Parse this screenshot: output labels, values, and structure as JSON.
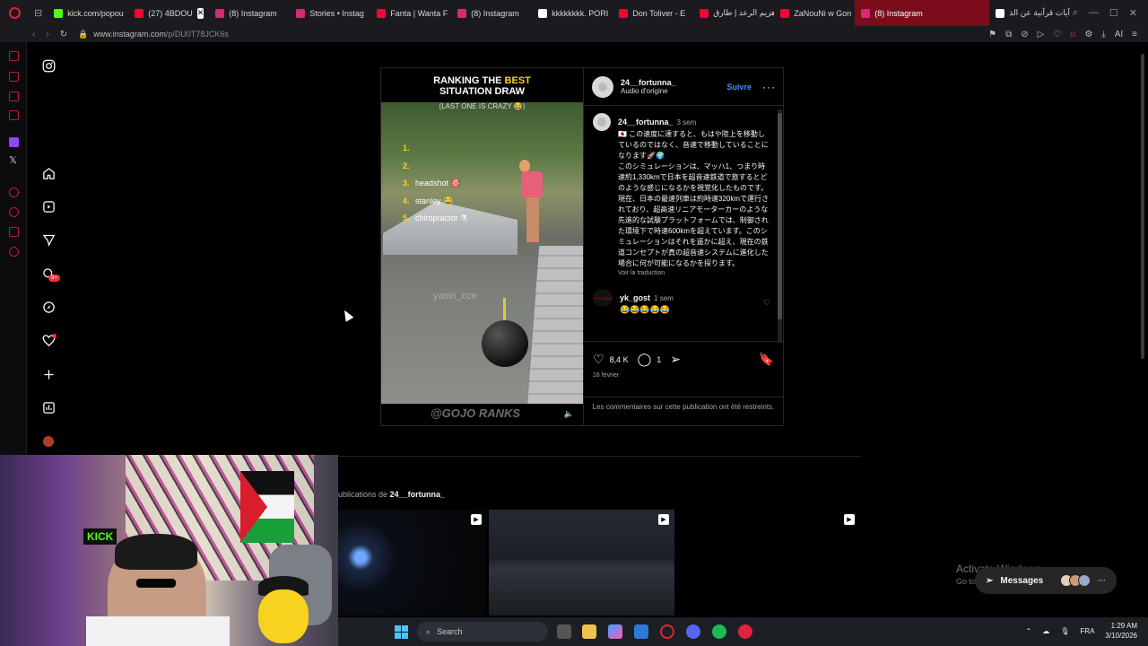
{
  "browser": {
    "tabs": [
      {
        "label": "kick.com/popou",
        "color": "#53fc18"
      },
      {
        "label": "(27) 4BDOU",
        "color": "#ff0033"
      },
      {
        "label": "(8) Instagram",
        "color": "#d62976"
      },
      {
        "label": "Stories • Instag",
        "color": "#d62976"
      },
      {
        "label": "Fanta | Wanta F",
        "color": "#ff0033"
      },
      {
        "label": "(8) Instagram",
        "color": "#d62976"
      },
      {
        "label": "kkkkkkkk. PORI",
        "color": "#ffffff"
      },
      {
        "label": "Don Toliver - E",
        "color": "#ff0033"
      },
      {
        "label": "هزيم الرعد | طارق",
        "color": "#ff0033"
      },
      {
        "label": "ZaNouNi w Gon",
        "color": "#ff0033"
      },
      {
        "label": "(8) Instagram",
        "color": "#d62976"
      },
      {
        "label": "آيات قرآنية عن الذ",
        "color": "#ffffff"
      }
    ],
    "url_host": "www.instagram.com",
    "url_path": "/p/DU0T78JCK6s",
    "ai_label": "AI"
  },
  "post": {
    "video": {
      "title_pre": "RANKING THE ",
      "title_accent": "BEST",
      "title_line2": "SITUATION DRAW",
      "title_sub": "(LAST ONE IS CRAZY 😂)",
      "ranks": [
        {
          "n": "1.",
          "label": ""
        },
        {
          "n": "2.",
          "label": ""
        },
        {
          "n": "3.",
          "label": "headshot 🎯"
        },
        {
          "n": "4.",
          "label": "stanley 😂"
        },
        {
          "n": "5.",
          "label": "chiropractor ⚗"
        }
      ],
      "watermark": "yasin_cce",
      "footer_tag": "@GOJO RANKS"
    },
    "author": "24__fortunna_",
    "audio": "Audio d'origine",
    "follow": "Suivre",
    "caption": {
      "user": "24__fortunna_",
      "time": "3 sem",
      "text": "🇯🇵 この速度に達すると、もはや陸上を移動しているのではなく、音速で移動していることになります🚀🌍\nこのシミュレーションは、マッハ1、つまり時速約1,330kmで日本を超音速鉄道で旅するとどのような感じになるかを視覚化したものです。現在、日本の最速列車は約時速320kmで運行されており、超高速リニアモーターカーのような先進的な試験プラットフォームでは、制御された環境下で時速600kmを超えています。このシミュレーションはそれを遥かに超え、現在の鉄道コンセプトが真の超音速システムに進化した場合に何が可能になるかを探ります。",
      "see_translation": "Voir la traduction"
    },
    "comment": {
      "avatar_text": "PCG GANG",
      "user": "yk_gost",
      "time": "1 sem",
      "text": "😂😂😂😂😂"
    },
    "likes": "8,4 K",
    "comments_count": "1",
    "date": "16 février",
    "restricted": "Les commentaires sur cette publication ont été restreints."
  },
  "more_from": {
    "prefix": "ublications de ",
    "user": "24__fortunna_"
  },
  "windows": {
    "activate_title": "Activate Windows",
    "activate_sub": "Go to",
    "messages": "Messages",
    "messages_badge": "8",
    "search": "Search",
    "lang": "FRA",
    "time": "1:29 AM",
    "date": "3/10/2026"
  },
  "webcam": {
    "kick_label": "KICK"
  }
}
